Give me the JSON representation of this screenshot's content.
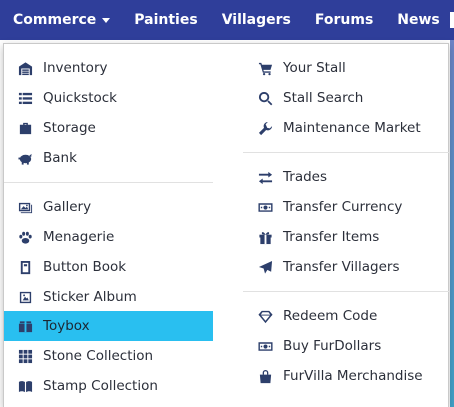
{
  "nav": {
    "items": [
      {
        "label": "Commerce",
        "has_caret": true
      },
      {
        "label": "Painties"
      },
      {
        "label": "Villagers"
      },
      {
        "label": "Forums"
      },
      {
        "label": "News"
      }
    ]
  },
  "dropdown": {
    "left": [
      {
        "label": "Inventory",
        "icon": "warehouse-icon"
      },
      {
        "label": "Quickstock",
        "icon": "list-icon"
      },
      {
        "label": "Storage",
        "icon": "suitcase-icon"
      },
      {
        "label": "Bank",
        "icon": "piggy-bank-icon"
      },
      {
        "label": "Gallery",
        "icon": "images-icon"
      },
      {
        "label": "Menagerie",
        "icon": "paw-icon"
      },
      {
        "label": "Button Book",
        "icon": "book-icon"
      },
      {
        "label": "Sticker Album",
        "icon": "sticker-icon"
      },
      {
        "label": "Toybox",
        "icon": "toybox-icon",
        "active": true
      },
      {
        "label": "Stone Collection",
        "icon": "grid-icon"
      },
      {
        "label": "Stamp Collection",
        "icon": "open-book-icon"
      }
    ],
    "right": [
      {
        "label": "Your Stall",
        "icon": "cart-icon"
      },
      {
        "label": "Stall Search",
        "icon": "search-icon"
      },
      {
        "label": "Maintenance Market",
        "icon": "wrench-icon"
      },
      {
        "label": "Trades",
        "icon": "exchange-icon"
      },
      {
        "label": "Transfer Currency",
        "icon": "money-icon"
      },
      {
        "label": "Transfer Items",
        "icon": "gift-icon"
      },
      {
        "label": "Transfer Villagers",
        "icon": "plane-icon"
      },
      {
        "label": "Redeem Code",
        "icon": "diamond-icon"
      },
      {
        "label": "Buy FurDollars",
        "icon": "money-icon"
      },
      {
        "label": "FurVilla Merchandise",
        "icon": "shopping-bag-icon"
      }
    ]
  },
  "colors": {
    "navbar": "#2f3e9a",
    "active_item": "#29bff0",
    "icon": "#2d3f6b"
  }
}
